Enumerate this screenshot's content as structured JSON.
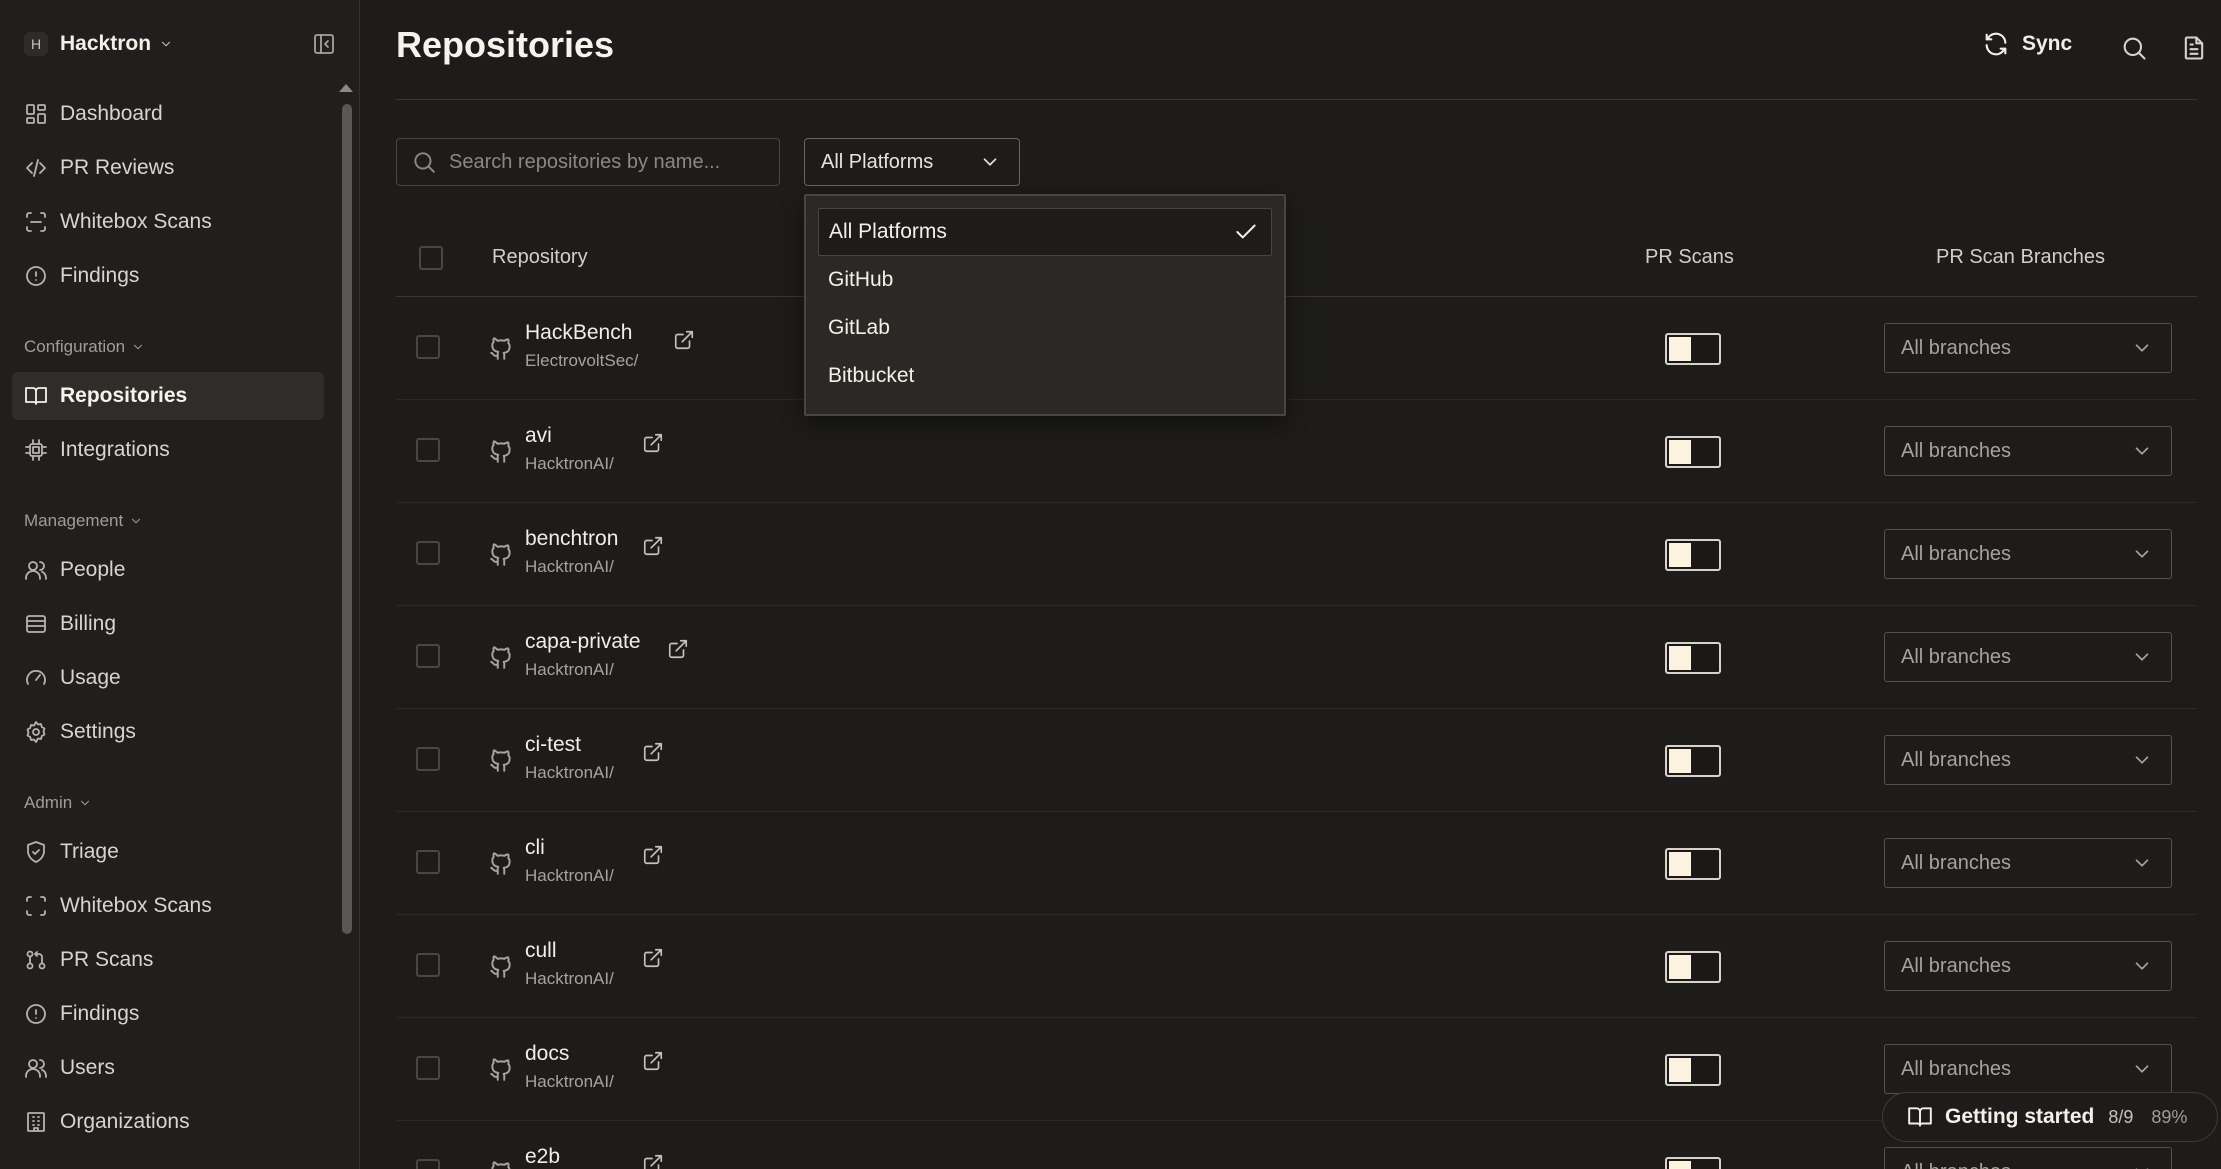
{
  "org": {
    "initial": "H",
    "name": "Hacktron"
  },
  "sidebar": {
    "top_items": [
      {
        "label": "Dashboard",
        "icon": "dashboard-icon"
      },
      {
        "label": "PR Reviews",
        "icon": "code-icon"
      },
      {
        "label": "Whitebox Scans",
        "icon": "scan-icon"
      },
      {
        "label": "Findings",
        "icon": "alert-circle-icon"
      }
    ],
    "configuration": {
      "label": "Configuration",
      "items": [
        {
          "label": "Repositories",
          "icon": "book-icon",
          "active": true
        },
        {
          "label": "Integrations",
          "icon": "chip-icon"
        }
      ]
    },
    "management": {
      "label": "Management",
      "items": [
        {
          "label": "People",
          "icon": "users-icon"
        },
        {
          "label": "Billing",
          "icon": "billing-icon"
        },
        {
          "label": "Usage",
          "icon": "gauge-icon"
        },
        {
          "label": "Settings",
          "icon": "gear-icon"
        }
      ]
    },
    "admin": {
      "label": "Admin",
      "items": [
        {
          "label": "Triage",
          "icon": "shield-check-icon"
        },
        {
          "label": "Whitebox Scans",
          "icon": "scan-icon"
        },
        {
          "label": "PR Scans",
          "icon": "git-pull-request-icon"
        },
        {
          "label": "Findings",
          "icon": "alert-circle-icon"
        },
        {
          "label": "Users",
          "icon": "users-icon"
        },
        {
          "label": "Organizations",
          "icon": "building-icon"
        }
      ]
    }
  },
  "page": {
    "title": "Repositories",
    "sync_label": "Sync",
    "search_placeholder": "Search repositories by name...",
    "platform_filter": "All Platforms"
  },
  "table": {
    "columns": {
      "repository": "Repository",
      "pr_scans": "PR Scans",
      "pr_scan_branches": "PR Scan Branches"
    },
    "rows": [
      {
        "name": "HackBench",
        "owner": "ElectrovoltSec/",
        "pr_scans": true,
        "branches": "All branches"
      },
      {
        "name": "avi",
        "owner": "HacktronAI/",
        "pr_scans": true,
        "branches": "All branches"
      },
      {
        "name": "benchtron",
        "owner": "HacktronAI/",
        "pr_scans": true,
        "branches": "All branches"
      },
      {
        "name": "capa-private",
        "owner": "HacktronAI/",
        "pr_scans": true,
        "branches": "All branches"
      },
      {
        "name": "ci-test",
        "owner": "HacktronAI/",
        "pr_scans": true,
        "branches": "All branches"
      },
      {
        "name": "cli",
        "owner": "HacktronAI/",
        "pr_scans": true,
        "branches": "All branches"
      },
      {
        "name": "cull",
        "owner": "HacktronAI/",
        "pr_scans": true,
        "branches": "All branches"
      },
      {
        "name": "docs",
        "owner": "HacktronAI/",
        "pr_scans": true,
        "branches": "All branches"
      },
      {
        "name": "e2b",
        "owner": "",
        "pr_scans": true,
        "branches": "All branches"
      }
    ]
  },
  "platform_dropdown": {
    "options": [
      "All Platforms",
      "GitHub",
      "GitLab",
      "Bitbucket"
    ],
    "selected": "All Platforms"
  },
  "getting_started": {
    "label": "Getting started",
    "steps": "8/9",
    "percent": "89%"
  }
}
